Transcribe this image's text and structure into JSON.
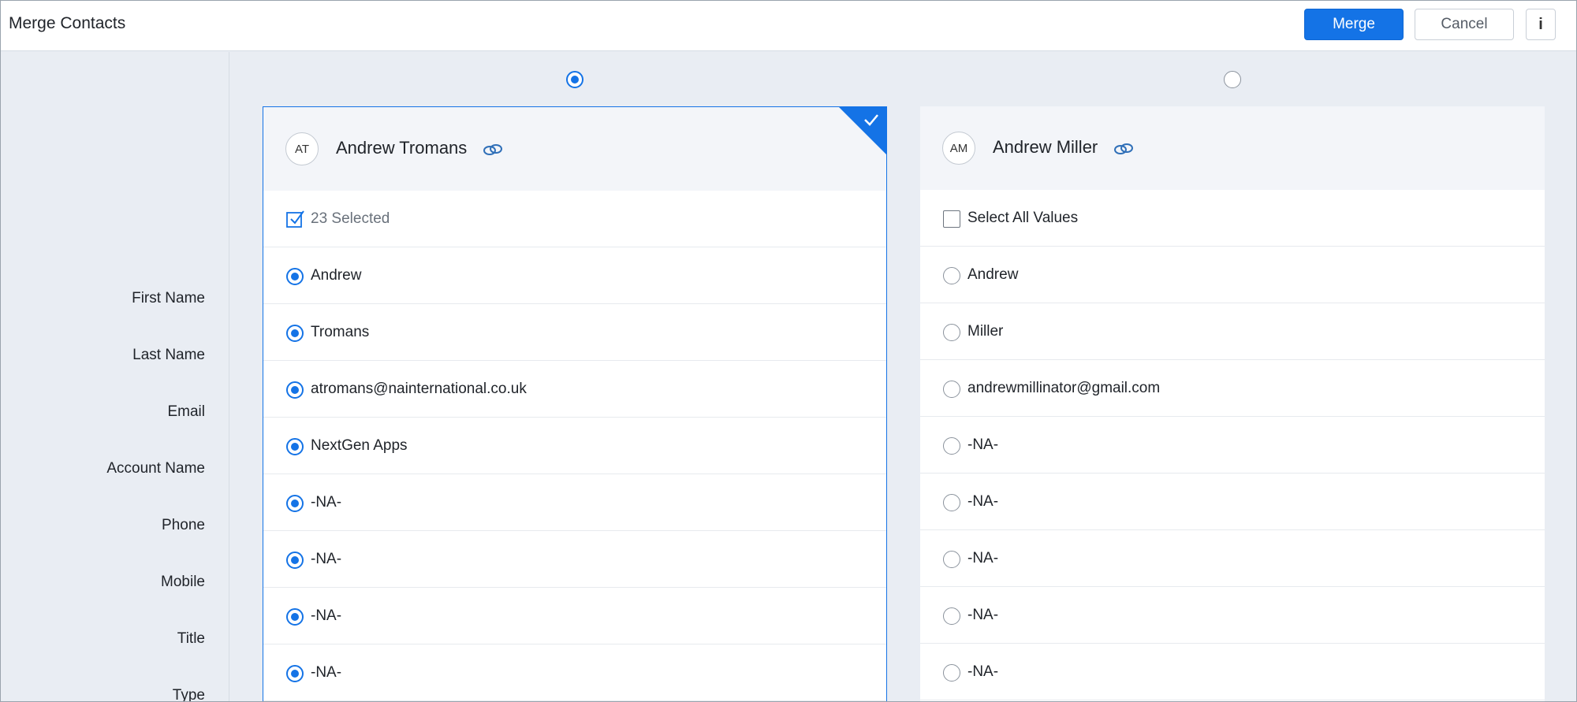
{
  "header": {
    "title": "Merge Contacts",
    "merge_label": "Merge",
    "cancel_label": "Cancel",
    "info_label": "i"
  },
  "fields": [
    "First Name",
    "Last Name",
    "Email",
    "Account Name",
    "Phone",
    "Mobile",
    "Title",
    "Type"
  ],
  "records": [
    {
      "initials": "AT",
      "name": "Andrew Tromans",
      "selected": true,
      "select_label": "23 Selected",
      "values": [
        "Andrew",
        "Tromans",
        "atromans@nainternational.co.uk",
        "NextGen Apps",
        "-NA-",
        "-NA-",
        "-NA-",
        "-NA-"
      ]
    },
    {
      "initials": "AM",
      "name": "Andrew Miller",
      "selected": false,
      "select_label": "Select All Values",
      "values": [
        "Andrew",
        "Miller",
        "andrewmillinator@gmail.com",
        "-NA-",
        "-NA-",
        "-NA-",
        "-NA-",
        "-NA-"
      ]
    }
  ],
  "colors": {
    "accent": "#1473e6",
    "background": "#e9edf3"
  },
  "icons": {
    "record_link": "linked-rings-icon",
    "master_marker": "checkmark-icon",
    "selected_count": "checked-box-icon"
  }
}
